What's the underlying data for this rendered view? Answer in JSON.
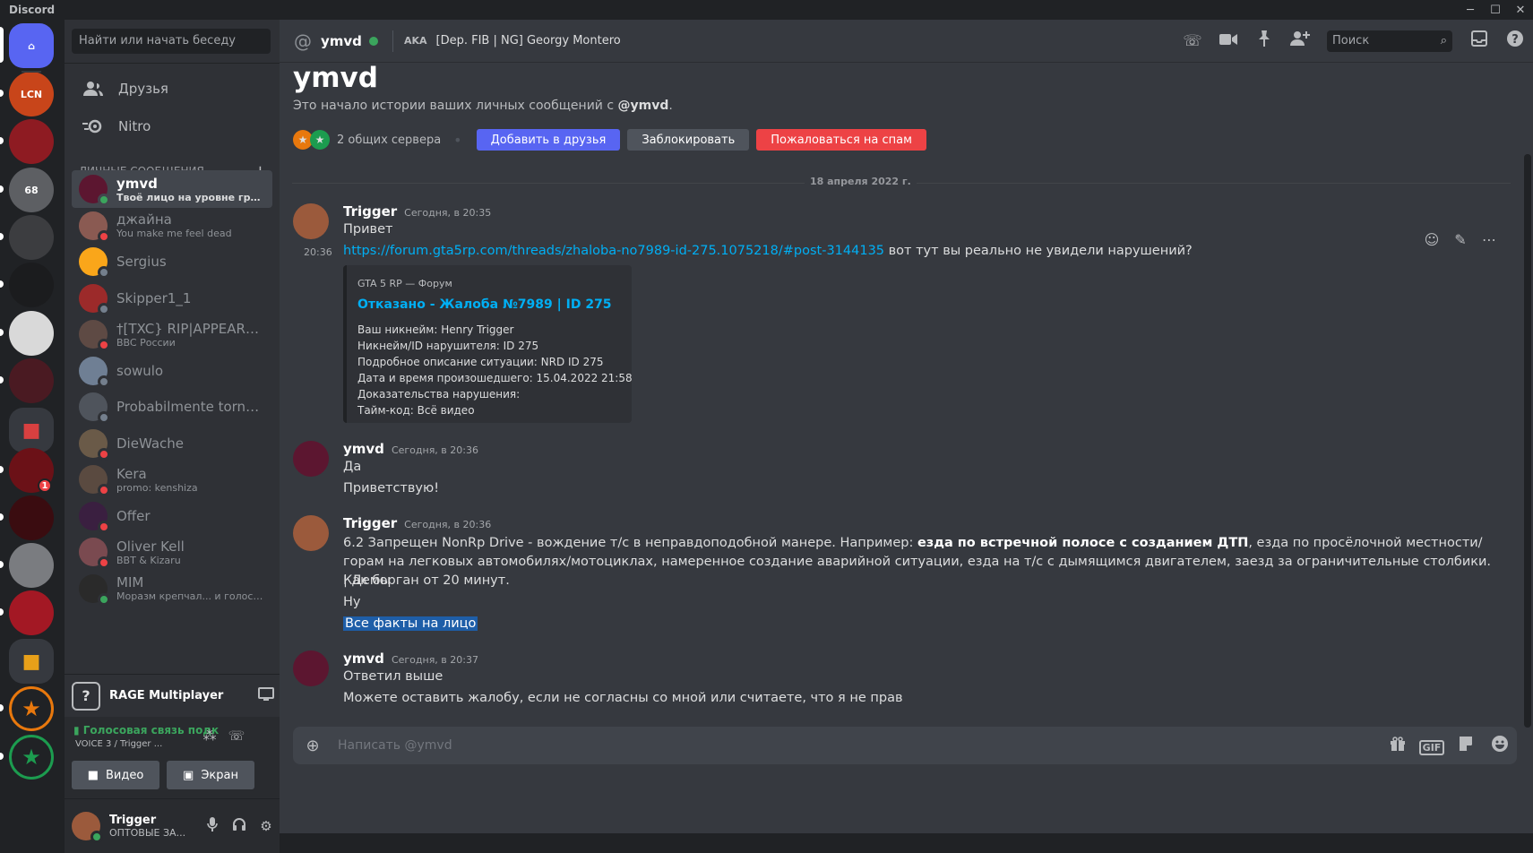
{
  "app": {
    "title": "Discord"
  },
  "window_controls": {
    "minimize": "─",
    "maximize": "☐",
    "close": "✕"
  },
  "guilds": [
    {
      "name": "discord-home",
      "label": "⌂",
      "color": "#5865f2"
    },
    {
      "name": "lcn",
      "label": "LCN",
      "color": "#c8451a"
    },
    {
      "name": "red-server",
      "label": "",
      "color": "#8e1b22"
    },
    {
      "name": "route68",
      "label": "68",
      "color": "#5d5f63"
    },
    {
      "name": "the-lost",
      "label": "",
      "color": "#3c3d40"
    },
    {
      "name": "dark-server",
      "label": "",
      "color": "#1b1c1e"
    },
    {
      "name": "wolf-server",
      "label": "",
      "color": "#d9d9d9"
    },
    {
      "name": "dark-red-server",
      "label": "",
      "color": "#4a1a22"
    },
    {
      "name": "folder-red",
      "label": "■",
      "color": "#36393f"
    },
    {
      "name": "sacra-server",
      "label": "",
      "color": "#6b1117",
      "badge": "1"
    },
    {
      "name": "mafia-server",
      "label": "",
      "color": "#3a0c10"
    },
    {
      "name": "city-server",
      "label": "",
      "color": "#7a7c80"
    },
    {
      "name": "show-server",
      "label": "",
      "color": "#a31824"
    },
    {
      "name": "folder-yellow",
      "label": "■",
      "color": "#36393f"
    },
    {
      "name": "gta5rp-orange",
      "label": "★",
      "color": "#e8780d"
    },
    {
      "name": "gta5rp-green",
      "label": "★",
      "color": "#1c9c4f"
    }
  ],
  "dm_search": {
    "placeholder": "Найти или начать беседу"
  },
  "nav": {
    "friends": "Друзья",
    "nitro": "Nitro"
  },
  "dm_header": {
    "label": "ЛИЧНЫЕ СООБЩЕНИЯ",
    "plus": "+"
  },
  "dms": [
    {
      "name": "ymvd",
      "sub": "Твоё лицо на уровне грун...",
      "status": "online",
      "color": "#5c1630",
      "active": true
    },
    {
      "name": "джайна",
      "sub": "You make me feel dead",
      "status": "dnd",
      "color": "#8a5a52"
    },
    {
      "name": "Sergius",
      "sub": "",
      "status": "offline",
      "color": "#faa61a"
    },
    {
      "name": "Skipper1_1",
      "sub": "",
      "status": "offline",
      "color": "#9c2a2a"
    },
    {
      "name": "†[TXC} RIP|APPEARE...",
      "sub": "BBC России",
      "status": "dnd",
      "color": "#5e4a44"
    },
    {
      "name": "sowulo",
      "sub": "",
      "status": "offline",
      "color": "#6f7f94"
    },
    {
      "name": "Probabilmente tornerò...",
      "sub": "",
      "status": "offline",
      "color": "#4f545c"
    },
    {
      "name": "DieWache",
      "sub": "",
      "status": "dnd",
      "color": "#6a5a48"
    },
    {
      "name": "Kera",
      "sub": "promo: kenshiza",
      "status": "dnd",
      "color": "#5a4a40"
    },
    {
      "name": "Offer",
      "sub": "",
      "status": "dnd",
      "color": "#3a1f40"
    },
    {
      "name": "Oliver Kell",
      "sub": "BBT & Kizaru",
      "status": "dnd",
      "color": "#7a4a50"
    },
    {
      "name": "MIM",
      "sub": "Моразм крепчал... и голос ра...",
      "status": "online",
      "color": "#2a2a2a"
    }
  ],
  "activity": {
    "title": "RAGE Multiplayer",
    "icon": "?"
  },
  "voice": {
    "status": "Голосовая связь подк",
    "channel": "VOICE 3 / Trigger ...",
    "video_button": "Видео",
    "screen_button": "Экран"
  },
  "user": {
    "name": "Trigger",
    "status": "ОПТОВЫЕ ЗА...",
    "color": "#9b5a3c"
  },
  "chat_header": {
    "at": "@",
    "name": "ymvd",
    "aka": "AKA",
    "nickname": "[Dep. FIB | NG] Georgy Montero",
    "search_placeholder": "Поиск"
  },
  "intro": {
    "title": "ymvd",
    "subtitle_prefix": "Это начало истории ваших личных сообщений с ",
    "subtitle_user": "@ymvd",
    "subtitle_suffix": ".",
    "mutual": "2 общих сервера",
    "add_friend": "Добавить в друзья",
    "block": "Заблокировать",
    "report_spam": "Пожаловаться на спам"
  },
  "date_divider": "18 апреля 2022 г.",
  "colors": {
    "blurple": "#5865f2",
    "danger": "#ed4245",
    "online": "#3ba55d",
    "dnd": "#ed4245",
    "offline": "#747f8d",
    "link": "#00aff4"
  },
  "messages": {
    "m1": {
      "author": "Trigger",
      "time": "Сегодня, в 20:35",
      "line1": "Привет",
      "side_time": "20:36",
      "link": "https://forum.gta5rp.com/threads/zhaloba-no7989-id-275.1075218/#post-3144135",
      "after_link": " вот тут вы реально не увидели нарушений?"
    },
    "embed": {
      "provider": "GTA 5 RP — Форум",
      "title": "Отказано - Жалоба №7989 | ID 275",
      "lines": [
        "Ваш никнейм: Henry Trigger",
        "Никнейм/ID нарушителя: ID 275",
        "Подробное описание ситуации: NRD ID 275",
        "Дата и время произошедшего: 15.04.2022 21:58",
        "Доказательства нарушения:",
        "Тайм-код: Всё видео"
      ]
    },
    "m2": {
      "author": "ymvd",
      "time": "Сегодня, в 20:36",
      "line1": "Да",
      "line2": "Приветствую!"
    },
    "m3": {
      "author": "Trigger",
      "time": "Сегодня, в 20:36",
      "rule_prefix": "6.2 Запрещен NonRp Drive - вождение т/с в неправдоподобной манере. Например: ",
      "rule_bold": "езда по встречной полосе с созданием ДТП",
      "rule_suffix": ", езда по просёлочной местности/горам на легковых автомобилях/мотоциклах, намеренное создание аварийной ситуации, езда на т/с с дымящимся двигателем, заезд за ограничительные столбики. | Деморган от 20 минут.",
      "line2": "Как бы",
      "line3": "Ну",
      "line4": "Все факты на лицо"
    },
    "m4": {
      "author": "ymvd",
      "time": "Сегодня, в 20:37",
      "line1": "Ответил выше",
      "line2": "Можете оставить жалобу, если не согласны со мной или считаете, что я не прав"
    }
  },
  "composer": {
    "placeholder": "Написать @ymvd",
    "gif": "GIF"
  }
}
